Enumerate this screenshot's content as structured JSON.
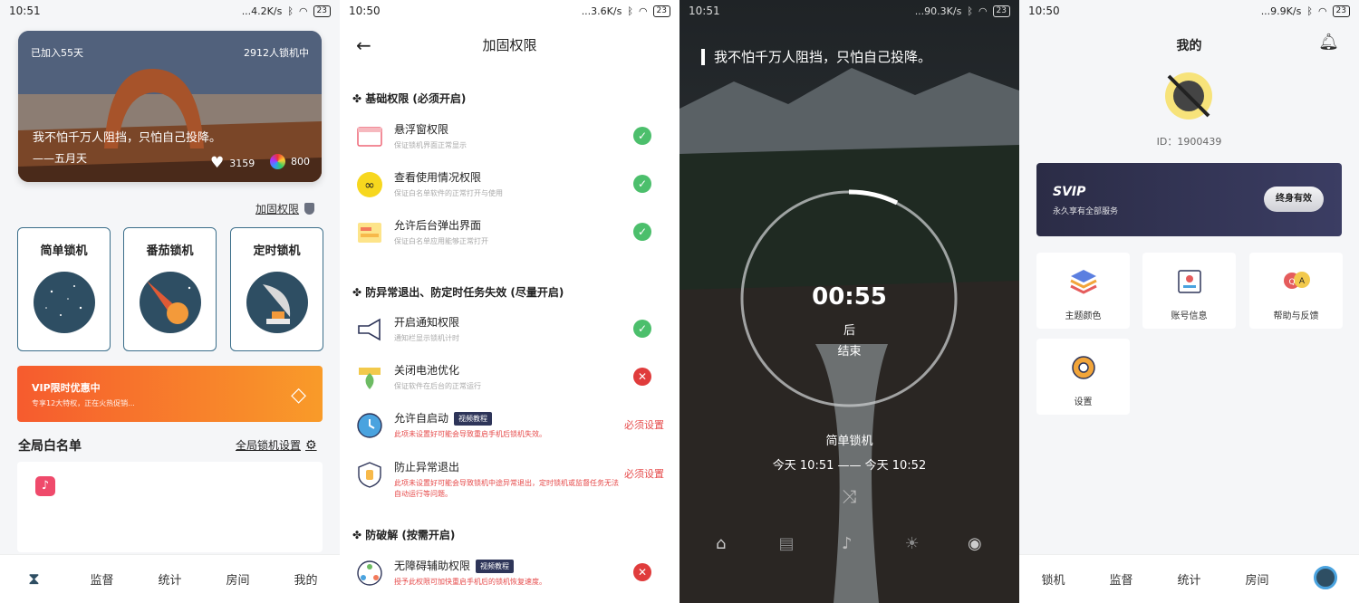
{
  "s1": {
    "status": {
      "time": "10:51",
      "speed": "...4.2K/s",
      "battery": "23"
    },
    "hero": {
      "joined": "已加入55天",
      "locking": "2912人锁机中",
      "quote": "我不怕千万人阻挡，只怕自己投降。",
      "author": "——五月天",
      "likes": "3159",
      "colors": "800"
    },
    "reinforce": "加固权限",
    "modes": [
      "简单锁机",
      "番茄锁机",
      "定时锁机"
    ],
    "vip": {
      "title": "VIP限时优惠中",
      "sub": "专享12大特权，正在火热促销..."
    },
    "whitelist": {
      "title": "全局白名单",
      "settings": "全局锁机设置"
    },
    "tabs": [
      "监督",
      "统计",
      "房间",
      "我的"
    ]
  },
  "s2": {
    "status": {
      "time": "10:50",
      "speed": "...3.6K/s",
      "battery": "23"
    },
    "title": "加固权限",
    "sections": [
      "基础权限 (必须开启)",
      "防异常退出、防定时任务失效 (尽量开启)",
      "防破解 (按需开启)"
    ],
    "perms": [
      {
        "name": "悬浮窗权限",
        "desc": "保证锁机界面正常显示",
        "status": "✓"
      },
      {
        "name": "查看使用情况权限",
        "desc": "保证白名单软件的正常打开与使用",
        "status": "✓"
      },
      {
        "name": "允许后台弹出界面",
        "desc": "保证白名单应用能够正常打开",
        "status": "✓"
      },
      {
        "name": "开启通知权限",
        "desc": "通知栏显示锁机计时",
        "status": "✓"
      },
      {
        "name": "关闭电池优化",
        "desc": "保证软件在后台的正常运行",
        "status": "✕"
      },
      {
        "name": "允许自启动",
        "desc": "此项未设置好可能会导致重启手机后锁机失效。",
        "status": "必须设置",
        "tag": "视频教程"
      },
      {
        "name": "防止异常退出",
        "desc": "此项未设置好可能会导致锁机中途异常退出，定时锁机或监督任务无法自动运行等问题。",
        "status": "必须设置"
      },
      {
        "name": "无障碍辅助权限",
        "desc": "授予此权限可加快重启手机后的锁机恢复速度。",
        "status": "✕",
        "tag": "视频教程"
      }
    ]
  },
  "s3": {
    "status": {
      "time": "10:51",
      "speed": "...90.3K/s",
      "battery": "23"
    },
    "quote": "我不怕千万人阻挡，只怕自己投降。",
    "countdown": "00:55",
    "after": "后",
    "end": "结束",
    "mode": "简单锁机",
    "range": "今天 10:51 —— 今天 10:52"
  },
  "s4": {
    "status": {
      "time": "10:50",
      "speed": "...9.9K/s",
      "battery": "23"
    },
    "title": "我的",
    "id": "ID：1900439",
    "svip": {
      "title": "SVIP",
      "sub": "永久享有全部服务",
      "btn": "终身有效"
    },
    "tiles": [
      "主题颜色",
      "账号信息",
      "帮助与反馈",
      "设置"
    ],
    "tabs": [
      "锁机",
      "监督",
      "统计",
      "房间"
    ]
  },
  "colors": {
    "accent": "#3b6e8a",
    "vip_orange": "#f65b2e",
    "ok": "#4cbf6c",
    "error": "#e03c3c",
    "svip_bg": "#2b2c46"
  }
}
